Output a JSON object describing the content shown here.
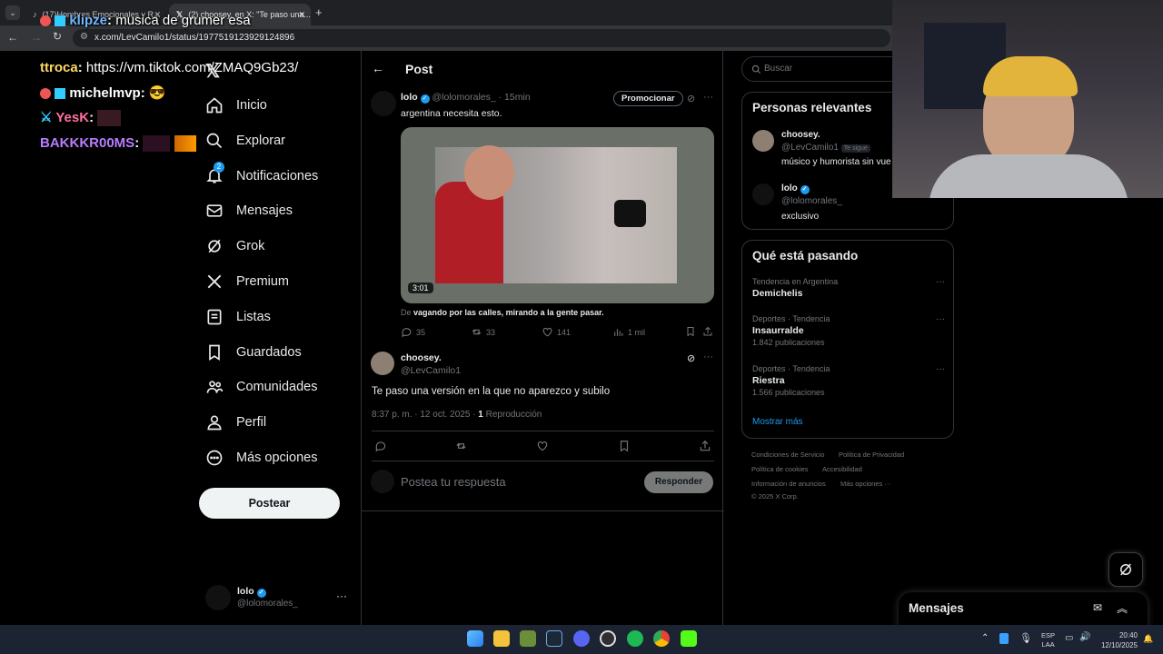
{
  "browser": {
    "tabs": [
      {
        "label": "(17)Hombres Emocionales y R..."
      },
      {
        "label": "(2) choosey. en X: \"Te paso una..."
      }
    ],
    "url": "x.com/LevCamilo1/status/1977519123929124896"
  },
  "stream_chat": [
    {
      "user": "klipze",
      "message": "musica de grumer esa",
      "user_color": "#6fb7ff"
    },
    {
      "user": "ttroca",
      "message": "https://vm.tiktok.com/ZMAQ9Gb23/",
      "user_color": "#ffd966"
    },
    {
      "user": "michelmvp",
      "message": "",
      "user_color": "#ffffff"
    },
    {
      "user": "YesK",
      "message": "",
      "user_color": "#ff6f9d"
    },
    {
      "user": "BAKKKR00MS",
      "message": "",
      "user_color": "#b87cff"
    }
  ],
  "nav": {
    "items": [
      {
        "label": "Inicio",
        "icon": "home-icon"
      },
      {
        "label": "Explorar",
        "icon": "search-icon"
      },
      {
        "label": "Notificaciones",
        "icon": "bell-icon",
        "badge": "2"
      },
      {
        "label": "Mensajes",
        "icon": "envelope-icon"
      },
      {
        "label": "Grok",
        "icon": "grok-icon"
      },
      {
        "label": "Premium",
        "icon": "x-logo-icon"
      },
      {
        "label": "Listas",
        "icon": "list-icon"
      },
      {
        "label": "Guardados",
        "icon": "bookmark-icon"
      },
      {
        "label": "Comunidades",
        "icon": "people-icon"
      },
      {
        "label": "Perfil",
        "icon": "person-icon"
      },
      {
        "label": "Más opciones",
        "icon": "more-circle-icon"
      }
    ],
    "post_button": "Postear",
    "account": {
      "name": "lolo",
      "handle": "@lolomorales_"
    }
  },
  "main": {
    "header": "Post",
    "quoted": {
      "author": "lolo",
      "handle": "@lolomorales_",
      "time": "· 15min",
      "promote": "Promocionar",
      "text": "argentina necesita esto.",
      "video_duration": "3:01",
      "from_prefix": "De",
      "from_source": "vagando por las calles, mirando a la gente pasar.",
      "replies": "35",
      "reposts": "33",
      "likes": "141",
      "views": "1 mil"
    },
    "post": {
      "author": "choosey.",
      "handle": "@LevCamilo1",
      "text": "Te paso una versión en la que no aparezco y subilo",
      "timestamp": "8:37 p. m. · 12 oct. 2025 · ",
      "plays_count": "1",
      "plays_label": " Reproducción"
    },
    "reply": {
      "placeholder": "Postea tu respuesta",
      "button": "Responder"
    }
  },
  "right": {
    "search_placeholder": "Buscar",
    "relevant": {
      "title": "Personas relevantes",
      "people": [
        {
          "name": "choosey.",
          "handle": "@LevCamilo1",
          "badge": "Te sigue",
          "bio": "músico y humorista sin vue"
        },
        {
          "name": "lolo",
          "handle": "@lolomorales_",
          "bio": "exclusivo"
        }
      ]
    },
    "trends": {
      "title": "Qué está pasando",
      "items": [
        {
          "meta": "Tendencia en Argentina",
          "name": "Demichelis",
          "count": ""
        },
        {
          "meta": "Deportes · Tendencia",
          "name": "Insaurralde",
          "count": "1.842 publicaciones"
        },
        {
          "meta": "Deportes · Tendencia",
          "name": "Riestra",
          "count": "1.566 publicaciones"
        }
      ],
      "show_more": "Mostrar más"
    },
    "footer": [
      "Condiciones de Servicio",
      "Política de Privacidad",
      "Política de cookies",
      "Accesibilidad",
      "Información de anuncios",
      "Más opciones ···",
      "© 2025 X Corp."
    ]
  },
  "dm_bar": {
    "label": "Mensajes"
  },
  "taskbar": {
    "lang": "ESP",
    "region": "LAA",
    "time": "20:40",
    "date": "12/10/2025"
  },
  "colors": {
    "accent": "#1d9bf0",
    "taskbar": "#1c2434"
  }
}
